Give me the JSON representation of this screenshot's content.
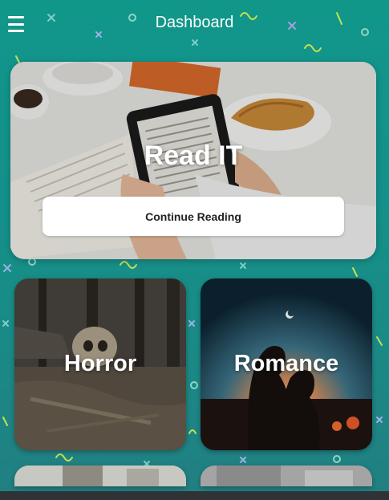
{
  "header": {
    "title": "Dashboard",
    "menu_icon": "hamburger-menu-icon"
  },
  "hero": {
    "title": "Read IT",
    "button_label": "Continue Reading",
    "image": "ereader-coffee-croissant-photo"
  },
  "genres": [
    {
      "label": "Horror",
      "image": "skull-forest-photo"
    },
    {
      "label": "Romance",
      "image": "couple-silhouette-sunset-photo"
    }
  ],
  "colors": {
    "background": "#14918a",
    "button_bg": "#ffffff",
    "button_text": "#222222"
  }
}
